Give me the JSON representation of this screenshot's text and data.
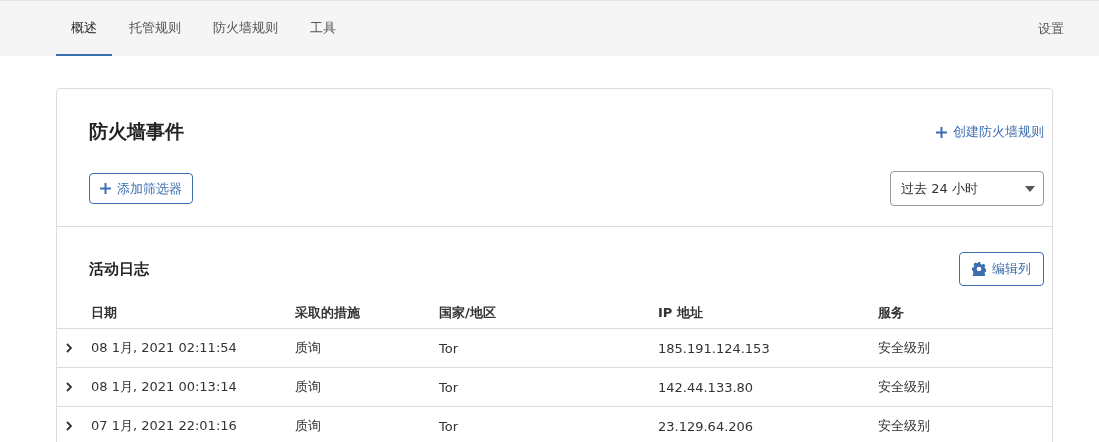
{
  "nav": {
    "tabs": [
      {
        "label": "概述",
        "selected": true
      },
      {
        "label": "托管规则",
        "selected": false
      },
      {
        "label": "防火墙规则",
        "selected": false
      },
      {
        "label": "工具",
        "selected": false
      }
    ],
    "settings": "设置"
  },
  "events": {
    "title": "防火墙事件",
    "create_link": "创建防火墙规则",
    "add_filter": "添加筛选器",
    "time_range": "过去 24 小时"
  },
  "activity_log": {
    "title": "活动日志",
    "edit_columns": "编辑列",
    "columns": [
      "日期",
      "采取的措施",
      "国家/地区",
      "IP 地址",
      "服务"
    ],
    "rows": [
      {
        "expanded": false,
        "cells": [
          "08 1月, 2021 02:11:54",
          "质询",
          "Tor",
          "185.191.124.153",
          "安全级别"
        ]
      },
      {
        "expanded": false,
        "cells": [
          "08 1月, 2021 00:13:14",
          "质询",
          "Tor",
          "142.44.133.80",
          "安全级别"
        ]
      },
      {
        "expanded": false,
        "cells": [
          "07 1月, 2021 22:01:16",
          "质询",
          "Tor",
          "23.129.64.206",
          "安全级别"
        ]
      }
    ]
  }
}
